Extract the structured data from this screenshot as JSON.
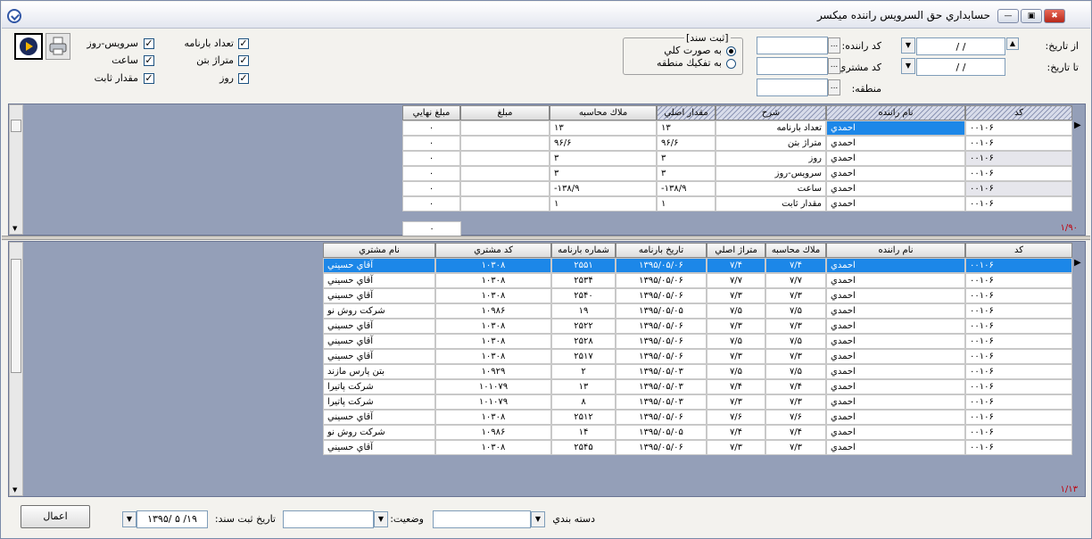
{
  "window": {
    "title": "حسابداري حق السرويس راننده ميكسر"
  },
  "filters": {
    "from_date_label": "از تاريخ:",
    "to_date_label": "تا تاريخ:",
    "driver_code_label": "كد راننده:",
    "customer_code_label": "كد مشتري:",
    "region_label": "منطقه:",
    "date_placeholder": "/   /",
    "dots": "..."
  },
  "record_group": {
    "title": "ثبت سند",
    "option_total": "به صورت كلي",
    "option_by_region": "به تفكيك منطقه",
    "selected": "به صورت كلي"
  },
  "checkboxes": [
    {
      "label": "تعداد بارنامه",
      "checked": true
    },
    {
      "label": "سرويس-روز",
      "checked": true
    },
    {
      "label": "متراژ بتن",
      "checked": true
    },
    {
      "label": "ساعت",
      "checked": true
    },
    {
      "label": "روز",
      "checked": true
    },
    {
      "label": "مقدار ثابت",
      "checked": true
    }
  ],
  "summary": {
    "columns": [
      "كد",
      "نام راننده",
      "شرح",
      "مقدار اصلي",
      "ملاك محاسبه",
      "مبلغ",
      "مبلغ نهايي"
    ],
    "rows": [
      [
        "۰۰۱۰۶",
        "احمدي",
        "تعداد بارنامه",
        "۱۳",
        "۱۳",
        "",
        "۰"
      ],
      [
        "۰۰۱۰۶",
        "احمدي",
        "متراژ بتن",
        "۹۶/۶",
        "۹۶/۶",
        "",
        "۰"
      ],
      [
        "۰۰۱۰۶",
        "احمدي",
        "روز",
        "۳",
        "۳",
        "",
        "۰"
      ],
      [
        "۰۰۱۰۶",
        "احمدي",
        "سرويس-روز",
        "۳",
        "۳",
        "",
        "۰"
      ],
      [
        "۰۰۱۰۶",
        "احمدي",
        "ساعت",
        "-۱۳۸/۹",
        "-۱۳۸/۹",
        "",
        "۰"
      ],
      [
        "۰۰۱۰۶",
        "احمدي",
        "مقدار ثابت",
        "۱",
        "۱",
        "",
        "۰"
      ]
    ],
    "total": "۰",
    "counter": "۱/۹۰"
  },
  "details": {
    "columns": [
      "كد",
      "نام راننده",
      "ملاك محاسبه",
      "متراژ اصلي",
      "تاريخ بارنامه",
      "شماره بارنامه",
      "كد مشتري",
      "نام مشتري"
    ],
    "rows": [
      [
        "۰۰۱۰۶",
        "احمدي",
        "۷/۴",
        "۷/۴",
        "۱۳۹۵/۰۵/۰۶",
        "۲۵۵۱",
        "۱۰۳۰۸",
        "آقاي حسيني"
      ],
      [
        "۰۰۱۰۶",
        "احمدي",
        "۷/۷",
        "۷/۷",
        "۱۳۹۵/۰۵/۰۶",
        "۲۵۳۴",
        "۱۰۳۰۸",
        "آقاي حسيني"
      ],
      [
        "۰۰۱۰۶",
        "احمدي",
        "۷/۳",
        "۷/۳",
        "۱۳۹۵/۰۵/۰۶",
        "۲۵۴۰",
        "۱۰۳۰۸",
        "آقاي حسيني"
      ],
      [
        "۰۰۱۰۶",
        "احمدي",
        "۷/۵",
        "۷/۵",
        "۱۳۹۵/۰۵/۰۵",
        "۱۹",
        "۱۰۹۸۶",
        "شركت روش نو"
      ],
      [
        "۰۰۱۰۶",
        "احمدي",
        "۷/۳",
        "۷/۳",
        "۱۳۹۵/۰۵/۰۶",
        "۲۵۲۲",
        "۱۰۳۰۸",
        "آقاي حسيني"
      ],
      [
        "۰۰۱۰۶",
        "احمدي",
        "۷/۵",
        "۷/۵",
        "۱۳۹۵/۰۵/۰۶",
        "۲۵۲۸",
        "۱۰۳۰۸",
        "آقاي حسيني"
      ],
      [
        "۰۰۱۰۶",
        "احمدي",
        "۷/۳",
        "۷/۳",
        "۱۳۹۵/۰۵/۰۶",
        "۲۵۱۷",
        "۱۰۳۰۸",
        "آقاي حسيني"
      ],
      [
        "۰۰۱۰۶",
        "احمدي",
        "۷/۵",
        "۷/۵",
        "۱۳۹۵/۰۵/۰۳",
        "۲",
        "۱۰۹۲۹",
        "بتن پارس مازند"
      ],
      [
        "۰۰۱۰۶",
        "احمدي",
        "۷/۴",
        "۷/۴",
        "۱۳۹۵/۰۵/۰۳",
        "۱۳",
        "۱۰۱۰۷۹",
        "شركت پاتيرا"
      ],
      [
        "۰۰۱۰۶",
        "احمدي",
        "۷/۳",
        "۷/۳",
        "۱۳۹۵/۰۵/۰۳",
        "۸",
        "۱۰۱۰۷۹",
        "شركت پاتيرا"
      ],
      [
        "۰۰۱۰۶",
        "احمدي",
        "۷/۶",
        "۷/۶",
        "۱۳۹۵/۰۵/۰۶",
        "۲۵۱۲",
        "۱۰۳۰۸",
        "آقاي حسيني"
      ],
      [
        "۰۰۱۰۶",
        "احمدي",
        "۷/۴",
        "۷/۴",
        "۱۳۹۵/۰۵/۰۵",
        "۱۴",
        "۱۰۹۸۶",
        "شركت روش نو"
      ],
      [
        "۰۰۱۰۶",
        "احمدي",
        "۷/۳",
        "۷/۳",
        "۱۳۹۵/۰۵/۰۶",
        "۲۵۴۵",
        "۱۰۳۰۸",
        "آقاي حسيني"
      ]
    ],
    "counter": "۱/۱۳"
  },
  "footer": {
    "category_label": "دسته بندي",
    "status_label": "وضعيت:",
    "record_date_label": "تاريخ ثبت سند:",
    "record_date_value": "۱۳۹۵/ ۵ /۱۹",
    "apply_button": "اعمال"
  }
}
